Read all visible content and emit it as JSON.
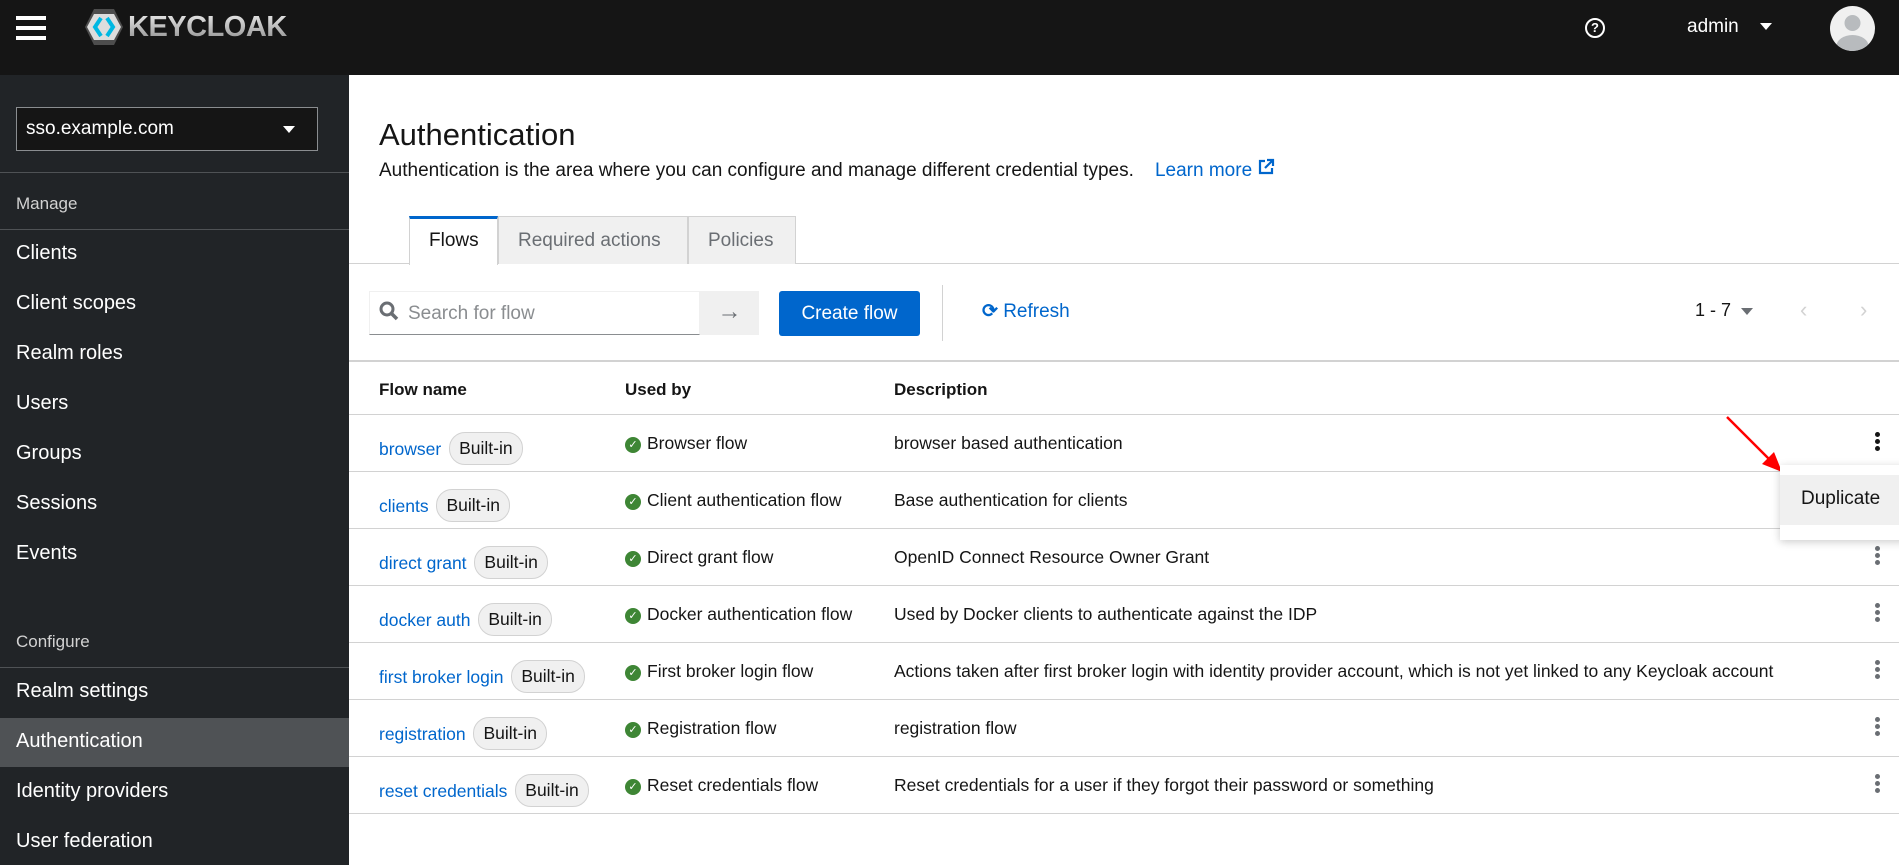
{
  "header": {
    "brand": "KEYCLOAK",
    "help_icon": "question-circle-icon",
    "user": "admin"
  },
  "sidebar": {
    "realm": "sso.example.com",
    "manage_label": "Manage",
    "configure_label": "Configure",
    "manage_items": [
      "Clients",
      "Client scopes",
      "Realm roles",
      "Users",
      "Groups",
      "Sessions",
      "Events"
    ],
    "configure_items": [
      "Realm settings",
      "Authentication",
      "Identity providers",
      "User federation"
    ],
    "active": "Authentication"
  },
  "page": {
    "title": "Authentication",
    "description": "Authentication is the area where you can configure and manage different credential types.",
    "learn_more": "Learn more"
  },
  "tabs": [
    {
      "label": "Flows",
      "active": true
    },
    {
      "label": "Required actions"
    },
    {
      "label": "Policies"
    }
  ],
  "toolbar": {
    "search_placeholder": "Search for flow",
    "create_label": "Create flow",
    "refresh_label": "Refresh",
    "pagination": "1 - 7"
  },
  "table": {
    "headers": [
      "Flow name",
      "Used by",
      "Description"
    ],
    "badge": "Built-in",
    "rows": [
      {
        "name": "browser",
        "used_by": "Browser flow",
        "description": "browser based authentication"
      },
      {
        "name": "clients",
        "used_by": "Client authentication flow",
        "description": "Base authentication for clients"
      },
      {
        "name": "direct grant",
        "used_by": "Direct grant flow",
        "description": "OpenID Connect Resource Owner Grant"
      },
      {
        "name": "docker auth",
        "used_by": "Docker authentication flow",
        "description": "Used by Docker clients to authenticate against the IDP"
      },
      {
        "name": "first broker login",
        "used_by": "First broker login flow",
        "description": "Actions taken after first broker login with identity provider account, which is not yet linked to any Keycloak account"
      },
      {
        "name": "registration",
        "used_by": "Registration flow",
        "description": "registration flow"
      },
      {
        "name": "reset credentials",
        "used_by": "Reset credentials flow",
        "description": "Reset credentials for a user if they forgot their password or something"
      }
    ]
  },
  "row_menu": {
    "items": [
      "Duplicate"
    ]
  },
  "colors": {
    "header": "#151515",
    "sidebar": "#212427",
    "accent": "#0066cc",
    "success": "#3e8635",
    "annotation_arrow": "#ff0000"
  }
}
